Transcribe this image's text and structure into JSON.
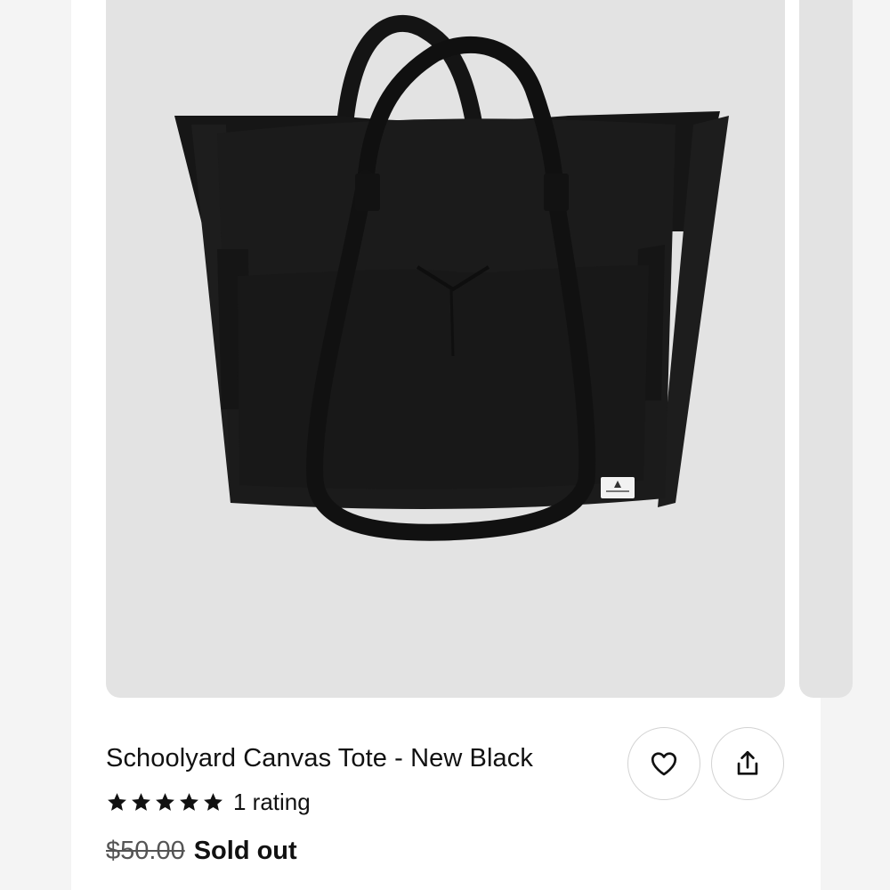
{
  "product": {
    "title": "Schoolyard Canvas Tote - New Black",
    "rating_count_label": "1 rating",
    "stars": 5,
    "original_price": "$50.00",
    "status": "Sold out"
  },
  "actions": {
    "favorite_icon": "heart-icon",
    "share_icon": "share-icon"
  },
  "colors": {
    "image_background": "#e3e3e3",
    "bag": "#1a1a1a",
    "text": "#111111"
  }
}
